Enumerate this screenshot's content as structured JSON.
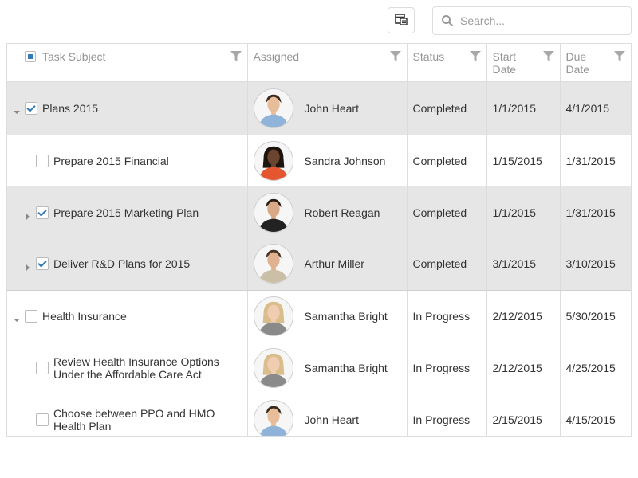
{
  "toolbar": {
    "column_chooser_icon": "column-chooser-icon",
    "search": {
      "placeholder": "Search...",
      "value": "",
      "icon": "search-icon"
    }
  },
  "columns": [
    "Task Subject",
    "Assigned",
    "Status",
    "Start Date",
    "Due Date"
  ],
  "colors": {
    "accent": "#337ab7",
    "selected_row": "#e6e6e6",
    "border": "#dddddd",
    "header_text": "#959595"
  },
  "rows": [
    {
      "subject": "Plans 2015",
      "level": 0,
      "expander": "expanded",
      "checked": true,
      "selected": true,
      "assigned": "John Heart",
      "avatar": "man-blue-shirt",
      "status": "Completed",
      "start": "1/1/2015",
      "due": "4/1/2015"
    },
    {
      "subject": "Prepare 2015 Financial",
      "level": 1,
      "expander": "none",
      "checked": false,
      "selected": false,
      "assigned": "Sandra Johnson",
      "avatar": "woman-red-top",
      "status": "Completed",
      "start": "1/15/2015",
      "due": "1/31/2015"
    },
    {
      "subject": "Prepare 2015 Marketing Plan",
      "level": 1,
      "expander": "collapsed",
      "checked": true,
      "selected": true,
      "assigned": "Robert Reagan",
      "avatar": "man-black-shirt",
      "status": "Completed",
      "start": "1/1/2015",
      "due": "1/31/2015"
    },
    {
      "subject": "Deliver R&D Plans for 2015",
      "level": 1,
      "expander": "collapsed",
      "checked": true,
      "selected": true,
      "assigned": "Arthur Miller",
      "avatar": "man-beige-shirt",
      "status": "Completed",
      "start": "3/1/2015",
      "due": "3/10/2015"
    },
    {
      "subject": "Health Insurance",
      "level": 0,
      "expander": "expanded",
      "checked": false,
      "selected": false,
      "assigned": "Samantha Bright",
      "avatar": "woman-gray-blazer",
      "status": "In Progress",
      "start": "2/12/2015",
      "due": "5/30/2015"
    },
    {
      "subject": "Review Health Insurance Options Under the Affordable Care Act",
      "level": 1,
      "expander": "none",
      "checked": false,
      "selected": false,
      "assigned": "Samantha Bright",
      "avatar": "woman-gray-blazer",
      "status": "In Progress",
      "start": "2/12/2015",
      "due": "4/25/2015"
    },
    {
      "subject": "Choose between PPO and HMO Health Plan",
      "level": 1,
      "expander": "none",
      "checked": false,
      "selected": false,
      "assigned": "John Heart",
      "avatar": "man-blue-shirt",
      "status": "In Progress",
      "start": "2/15/2015",
      "due": "4/15/2015"
    }
  ]
}
